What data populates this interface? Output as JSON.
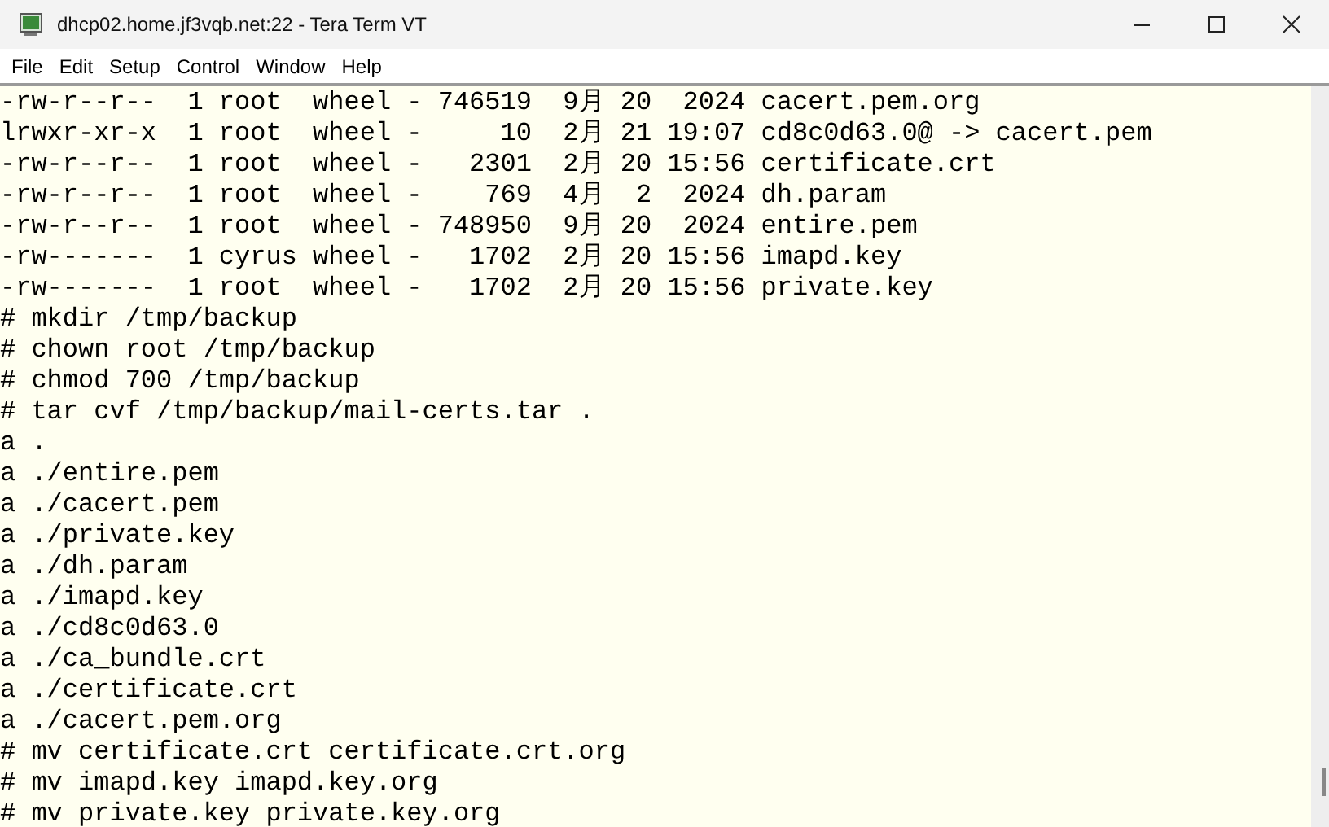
{
  "window": {
    "title": "dhcp02.home.jf3vqb.net:22 - Tera Term VT"
  },
  "menu": [
    "File",
    "Edit",
    "Setup",
    "Control",
    "Window",
    "Help"
  ],
  "terminal": {
    "lines": [
      "-rw-r--r--  1 root  wheel - 746519  9月 20  2024 cacert.pem.org",
      "lrwxr-xr-x  1 root  wheel -     10  2月 21 19:07 cd8c0d63.0@ -> cacert.pem",
      "-rw-r--r--  1 root  wheel -   2301  2月 20 15:56 certificate.crt",
      "-rw-r--r--  1 root  wheel -    769  4月  2  2024 dh.param",
      "-rw-r--r--  1 root  wheel - 748950  9月 20  2024 entire.pem",
      "-rw-------  1 cyrus wheel -   1702  2月 20 15:56 imapd.key",
      "-rw-------  1 root  wheel -   1702  2月 20 15:56 private.key",
      "# mkdir /tmp/backup",
      "# chown root /tmp/backup",
      "# chmod 700 /tmp/backup",
      "# tar cvf /tmp/backup/mail-certs.tar .",
      "a .",
      "a ./entire.pem",
      "a ./cacert.pem",
      "a ./private.key",
      "a ./dh.param",
      "a ./imapd.key",
      "a ./cd8c0d63.0",
      "a ./ca_bundle.crt",
      "a ./certificate.crt",
      "a ./cacert.pem.org",
      "# mv certificate.crt certificate.crt.org",
      "# mv imapd.key imapd.key.org",
      "# mv private.key private.key.org"
    ]
  }
}
